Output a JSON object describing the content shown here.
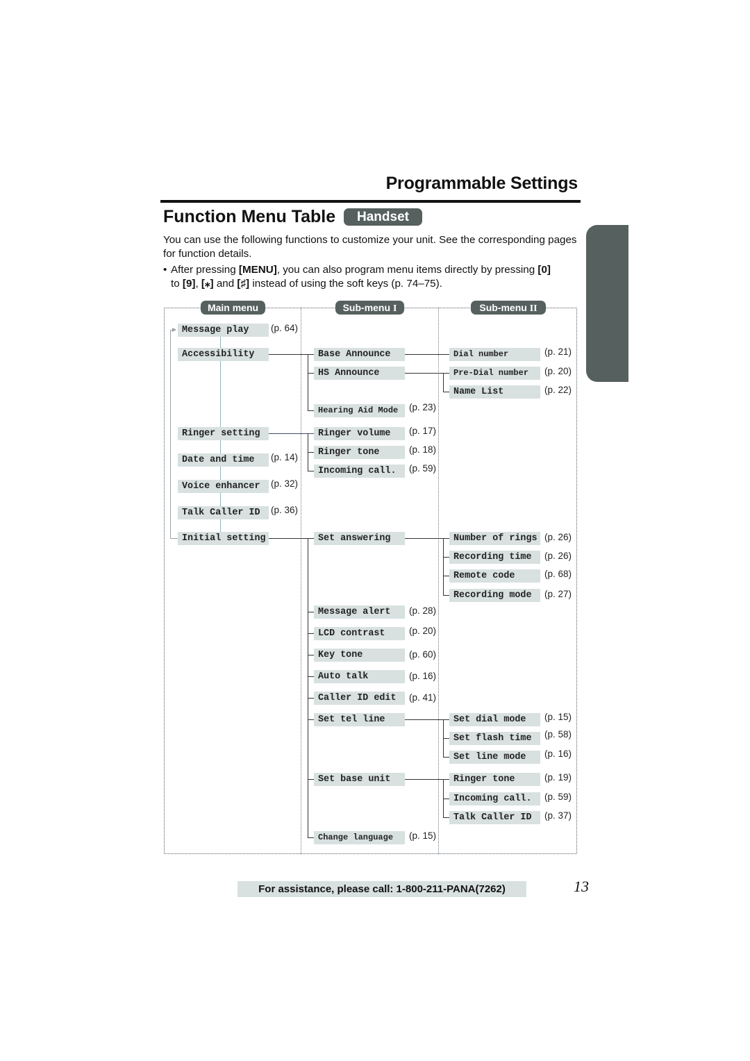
{
  "header": {
    "section_title": "Programmable Settings",
    "page_heading": "Function Menu Table",
    "badge": "Handset"
  },
  "intro": {
    "paragraph": "You can use the following functions to customize your unit. See the corresponding pages for function details.",
    "bullet_marker": "•",
    "bullet_parts": {
      "p1": "After pressing ",
      "k1": "[MENU]",
      "p2": ", you can also program menu items directly by pressing ",
      "k2": "[0]",
      "p3": " to ",
      "k3": "[9]",
      "p4": ", ",
      "k4": "[⁎]",
      "p5": " and ",
      "k5": "[♯]",
      "p6": " instead of using the soft keys (p. 74–75)."
    }
  },
  "columns": {
    "main": "Main menu",
    "sub1": "Sub-menu",
    "sub1_roman": "I",
    "sub2": "Sub-menu",
    "sub2_roman": "II"
  },
  "main_menu": [
    {
      "label": "Message play",
      "page": "(p. 64)"
    },
    {
      "label": "Accessibility",
      "page": ""
    },
    {
      "label": "Ringer setting",
      "page": ""
    },
    {
      "label": "Date and time",
      "page": "(p. 14)"
    },
    {
      "label": "Voice enhancer",
      "page": "(p. 32)"
    },
    {
      "label": "Talk Caller ID",
      "page": "(p. 36)"
    },
    {
      "label": "Initial setting",
      "page": ""
    }
  ],
  "sub_menu_1": {
    "accessibility": [
      {
        "label": "Base Announce",
        "page": ""
      },
      {
        "label": "HS Announce",
        "page": ""
      },
      {
        "label": "Hearing Aid Mode",
        "page": "(p. 23)"
      }
    ],
    "ringer_setting": [
      {
        "label": "Ringer volume",
        "page": "(p. 17)"
      },
      {
        "label": "Ringer tone",
        "page": "(p. 18)"
      },
      {
        "label": "Incoming call.",
        "page": "(p. 59)"
      }
    ],
    "initial_setting": [
      {
        "label": "Set answering",
        "page": ""
      },
      {
        "label": "Message alert",
        "page": "(p. 28)"
      },
      {
        "label": "LCD contrast",
        "page": "(p. 20)"
      },
      {
        "label": "Key tone",
        "page": "(p. 60)"
      },
      {
        "label": "Auto talk",
        "page": "(p. 16)"
      },
      {
        "label": "Caller ID edit",
        "page": "(p. 41)"
      },
      {
        "label": "Set tel line",
        "page": ""
      },
      {
        "label": "Set base unit",
        "page": ""
      },
      {
        "label": "Change language",
        "page": "(p. 15)"
      }
    ]
  },
  "sub_menu_2": {
    "base_announce": [
      {
        "label": "Dial number",
        "page": "(p. 21)"
      }
    ],
    "hs_announce": [
      {
        "label": "Pre-Dial number",
        "page": "(p. 20)"
      },
      {
        "label": "Name List",
        "page": "(p. 22)"
      }
    ],
    "set_answering": [
      {
        "label": "Number of rings",
        "page": "(p. 26)"
      },
      {
        "label": "Recording time",
        "page": "(p. 26)"
      },
      {
        "label": "Remote code",
        "page": "(p. 68)"
      },
      {
        "label": "Recording mode",
        "page": "(p. 27)"
      }
    ],
    "set_tel_line": [
      {
        "label": "Set dial mode",
        "page": "(p. 15)"
      },
      {
        "label": "Set flash time",
        "page": "(p. 58)"
      },
      {
        "label": "Set line mode",
        "page": "(p. 16)"
      }
    ],
    "set_base_unit": [
      {
        "label": "Ringer tone",
        "page": "(p. 19)"
      },
      {
        "label": "Incoming call.",
        "page": "(p. 59)"
      },
      {
        "label": "Talk Caller ID",
        "page": "(p. 37)"
      }
    ]
  },
  "footer": {
    "assistance": "For assistance, please call: 1-800-211-PANA(7262)",
    "page_number": "13"
  },
  "colors": {
    "badge_bg": "#56605f",
    "item_bg": "#d8e0e0",
    "text": "#111111"
  }
}
